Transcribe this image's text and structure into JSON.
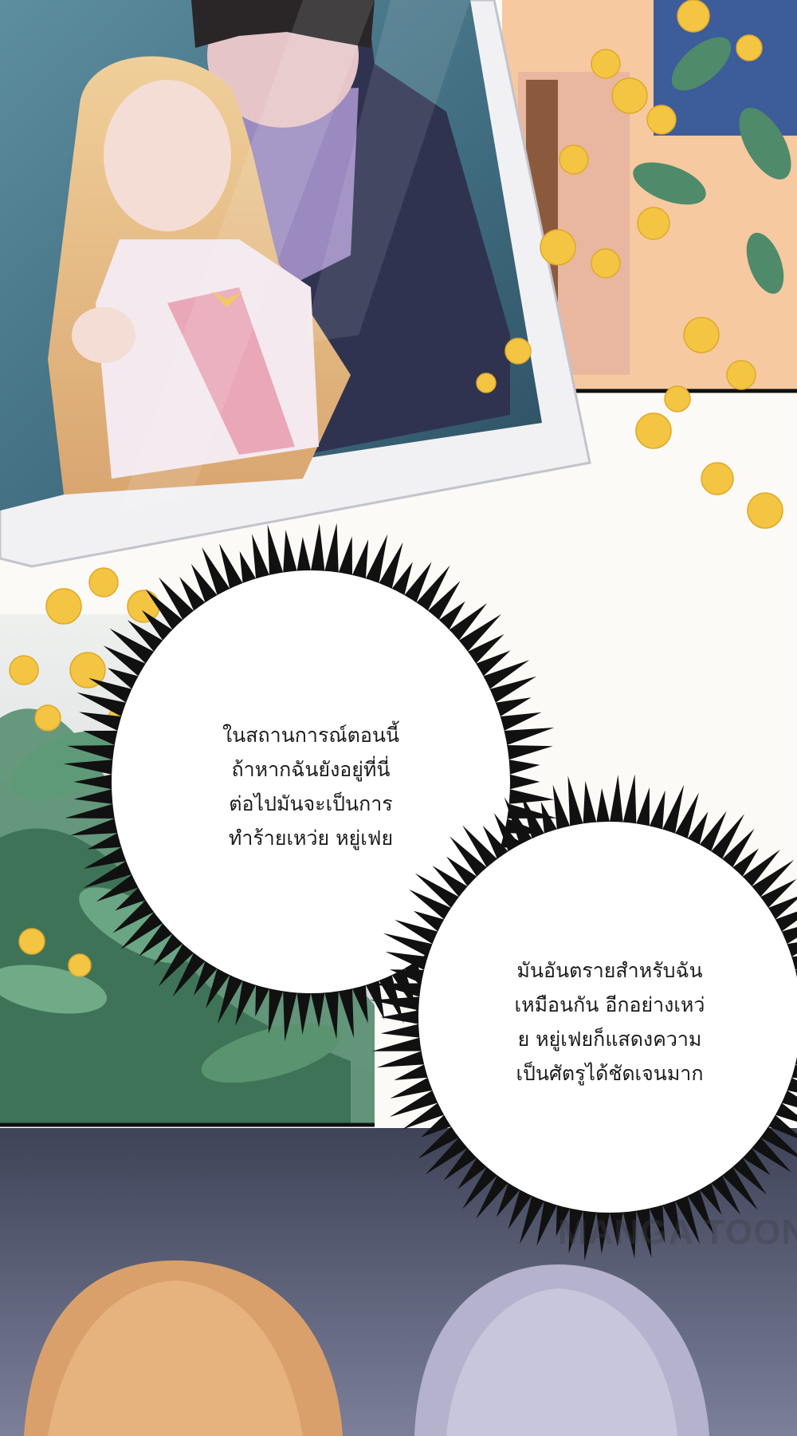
{
  "bubbles": [
    {
      "lines": [
        "ในสถานการณ์ตอนนี้",
        "ถ้าหากฉันยังอยู่ที่นี่",
        "ต่อไปมันจะเป็นการ",
        "ทำร้ายเหว่ย หยู่เฟย"
      ]
    },
    {
      "lines": [
        "มันอันตรายสำหรับฉัน",
        "เหมือนกัน อีกอย่างเหว่",
        "ย หยู่เฟยก็แสดงความ",
        "เป็นศัตรูได้ชัดเจนมาก"
      ]
    }
  ],
  "watermark": "MANGA TOON",
  "colors": {
    "photo_bg": "#3f6d80",
    "frame": "#f4f4f6",
    "flowers": "#f3c542",
    "leaves": "#4f8a6a",
    "bottom_panel": "#5b5f7a",
    "bubble_spikes": "#111111"
  }
}
